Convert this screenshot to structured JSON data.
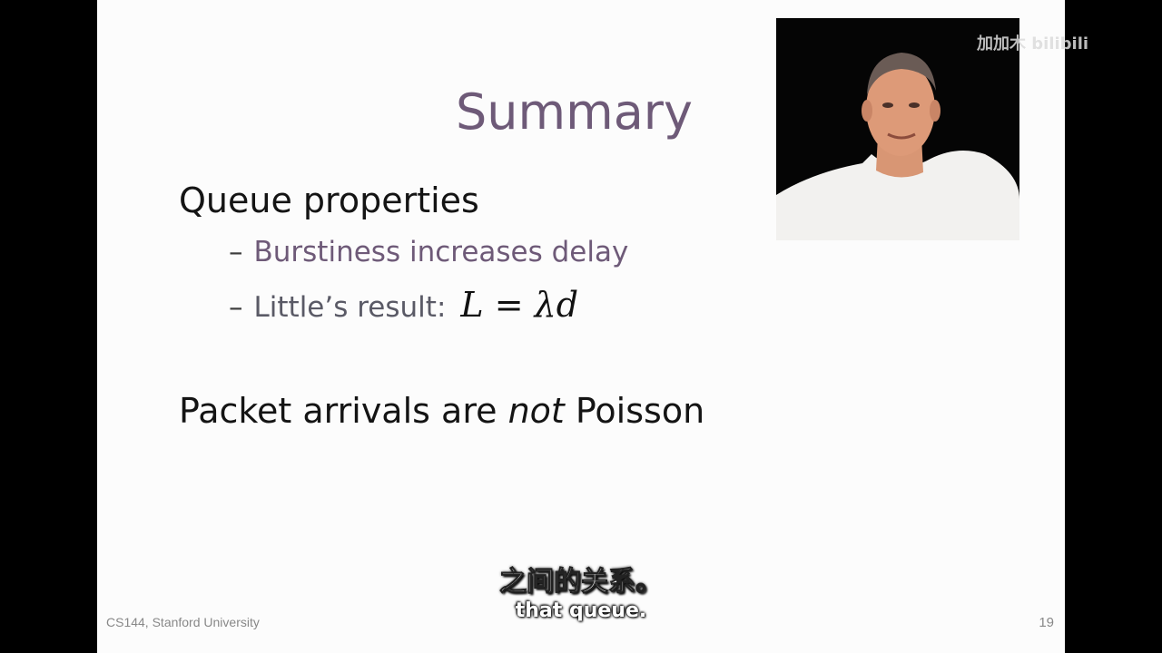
{
  "slide": {
    "title": "Summary",
    "bullets": [
      {
        "text": "Queue properties"
      },
      {
        "prefix": "Packet arrivals are ",
        "emphasis": "not",
        "suffix": " Poisson"
      }
    ],
    "sub_bullets": [
      {
        "dash": "–",
        "text": "Burstiness increases delay"
      },
      {
        "dash": "–",
        "text": "Little’s result:",
        "formula": "L = λd"
      }
    ],
    "footer_left": "CS144, Stanford University",
    "page_number": "19"
  },
  "video": {
    "watermark": "加加木 bilibili"
  },
  "subtitles": {
    "chinese": "之间的关系。",
    "english": "that queue."
  }
}
